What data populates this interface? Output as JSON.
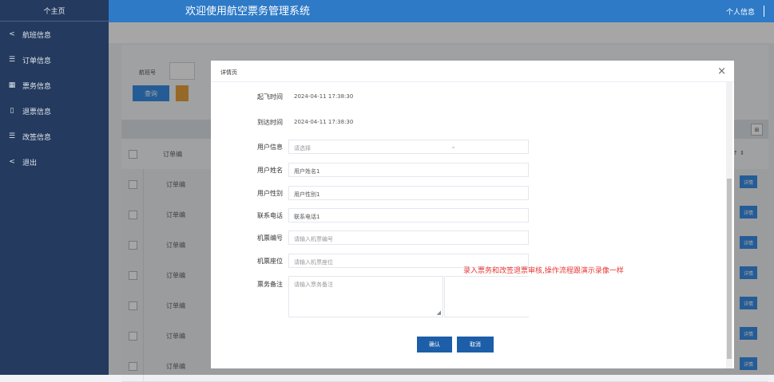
{
  "sidebar": {
    "home": "个主页",
    "items": [
      {
        "icon": "<",
        "label": "航班信息"
      },
      {
        "icon": "☰",
        "label": "订单信息"
      },
      {
        "icon": "▦",
        "label": "票务信息"
      },
      {
        "icon": "▯",
        "label": "退票信息"
      },
      {
        "icon": "☰",
        "label": "改签信息"
      },
      {
        "icon": "<",
        "label": "退出"
      }
    ]
  },
  "topbar": {
    "title": "欢迎使用航空票务管理系统",
    "profile": "个人信息"
  },
  "page": {
    "search_label": "航班号",
    "query_button": "查询",
    "table": {
      "rows": [
        "订单编",
        "订单编",
        "订单编",
        "订单编",
        "订单编",
        "订单编",
        "订单编"
      ],
      "detail_button": "详情",
      "header_partial": "订单编",
      "header_right": "↑ ⇕"
    }
  },
  "dialog": {
    "title": "详情页",
    "close": "×",
    "fields": {
      "takeoff_label": "起飞时间",
      "takeoff_value": "2024-04-11 17:38:30",
      "arrival_label": "到达时间",
      "arrival_value": "2024-04-11 17:38:30",
      "user_info_label": "用户信息",
      "user_info_placeholder": "请选择",
      "user_name_label": "用户姓名",
      "user_name_value": "用户姓名1",
      "user_gender_label": "用户性别",
      "user_gender_value": "用户性别1",
      "phone_label": "联系电话",
      "phone_value": "联系电话1",
      "ticket_no_label": "机票编号",
      "ticket_no_placeholder": "请输入机票编号",
      "seat_label": "机票座位",
      "seat_placeholder": "请输入机票座位",
      "remark_label": "票务备注",
      "remark_placeholder": "请输入票务备注"
    },
    "annotation": "录入票务和改签退票审核,操作流程跟演示录像一样",
    "confirm": "确认",
    "cancel": "取消"
  },
  "colors": {
    "sidebar": "#243a5e",
    "topbar": "#2e7ac7",
    "primary": "#3a8ee6",
    "annotation": "#e53935"
  }
}
